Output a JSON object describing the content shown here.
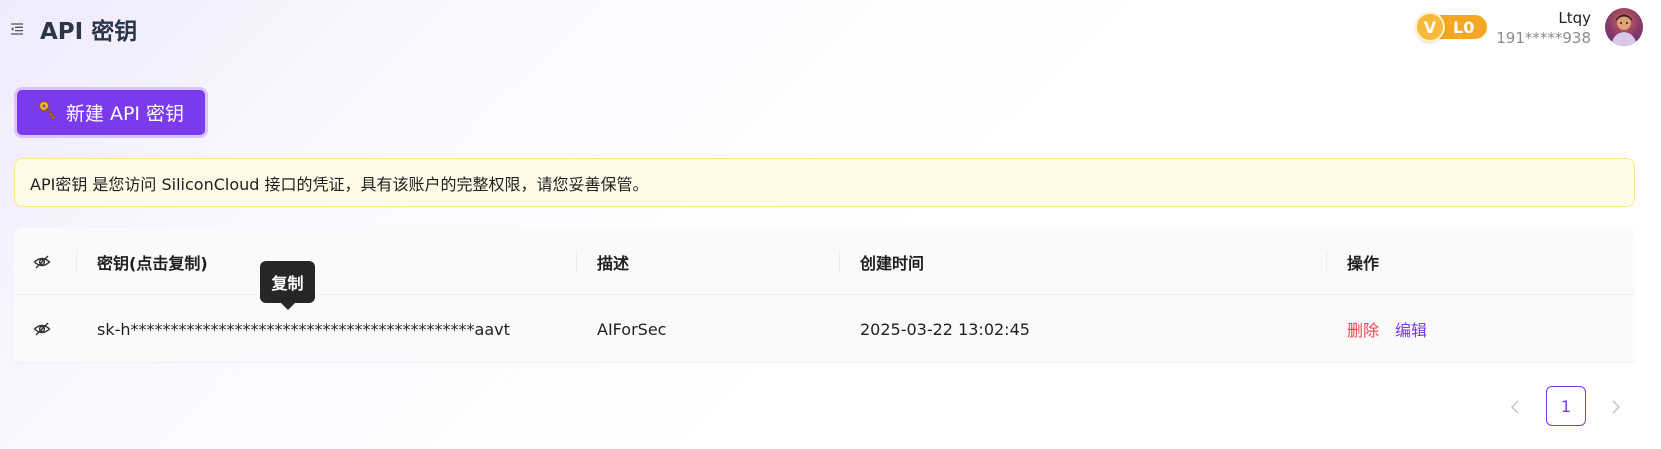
{
  "header": {
    "title": "API 密钥",
    "vip_level": "L0",
    "vip_symbol": "V",
    "user_name": "Ltqy",
    "user_phone": "191*****938"
  },
  "actions": {
    "create_label": "新建 API 密钥",
    "create_icon": "key-icon"
  },
  "notice": {
    "text": "API密钥 是您访问 SiliconCloud 接口的凭证，具有该账户的完整权限，请您妥善保管。"
  },
  "table": {
    "columns": {
      "key": "密钥(点击复制)",
      "description": "描述",
      "created": "创建时间",
      "operations": "操作"
    },
    "rows": [
      {
        "key": "sk-h*******************************************aavt",
        "description": "AIForSec",
        "created": "2025-03-22 13:02:45",
        "delete": "删除",
        "edit": "编辑"
      }
    ]
  },
  "tooltip": {
    "text": "复制"
  },
  "pagination": {
    "current_page": "1",
    "prev_icon": "chevron-left-icon",
    "next_icon": "chevron-right-icon"
  },
  "colors": {
    "accent": "#7c3aed",
    "danger": "#e5484d",
    "vip": "#f5a623",
    "notice_bg": "#fffbe6"
  }
}
